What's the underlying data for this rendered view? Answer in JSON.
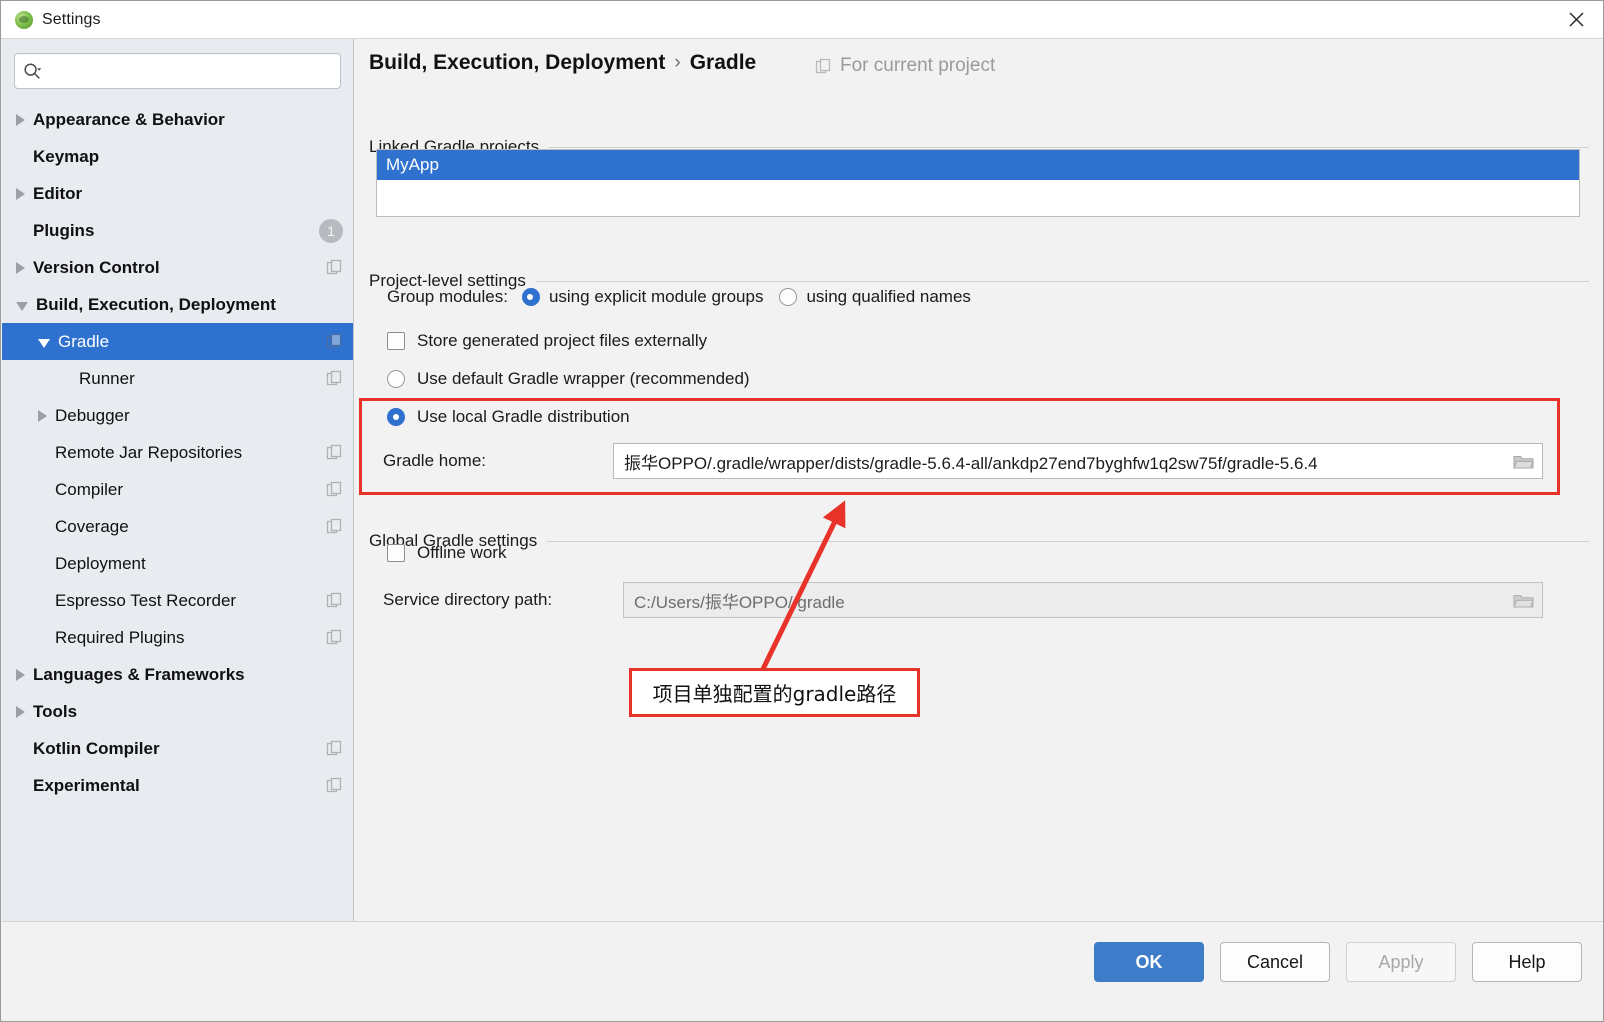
{
  "window": {
    "title": "Settings",
    "app_icon": "android-studio-icon",
    "close_icon": "close-icon"
  },
  "sidebar": {
    "search": {
      "value": "",
      "placeholder": "",
      "icon": "search-icon"
    },
    "items": [
      {
        "label": "Appearance & Behavior",
        "level": 0,
        "bold": true,
        "arrow": "collapsed",
        "badge": "",
        "config_icon": false,
        "selected": false
      },
      {
        "label": "Keymap",
        "level": 0,
        "bold": true,
        "arrow": "none",
        "badge": "",
        "config_icon": false,
        "selected": false
      },
      {
        "label": "Editor",
        "level": 0,
        "bold": true,
        "arrow": "collapsed",
        "badge": "",
        "config_icon": false,
        "selected": false
      },
      {
        "label": "Plugins",
        "level": 0,
        "bold": true,
        "arrow": "none",
        "badge": "1",
        "config_icon": false,
        "selected": false
      },
      {
        "label": "Version Control",
        "level": 0,
        "bold": true,
        "arrow": "collapsed",
        "badge": "",
        "config_icon": true,
        "selected": false
      },
      {
        "label": "Build, Execution, Deployment",
        "level": 0,
        "bold": true,
        "arrow": "expanded",
        "badge": "",
        "config_icon": false,
        "selected": false
      },
      {
        "label": "Gradle",
        "level": 1,
        "bold": false,
        "arrow": "expanded",
        "badge": "",
        "config_icon": true,
        "selected": true
      },
      {
        "label": "Runner",
        "level": 2,
        "bold": false,
        "arrow": "none",
        "badge": "",
        "config_icon": true,
        "selected": false
      },
      {
        "label": "Debugger",
        "level": 1,
        "bold": false,
        "arrow": "collapsed",
        "badge": "",
        "config_icon": false,
        "selected": false
      },
      {
        "label": "Remote Jar Repositories",
        "level": 1,
        "bold": false,
        "arrow": "none",
        "badge": "",
        "config_icon": true,
        "selected": false
      },
      {
        "label": "Compiler",
        "level": 1,
        "bold": false,
        "arrow": "none",
        "badge": "",
        "config_icon": true,
        "selected": false
      },
      {
        "label": "Coverage",
        "level": 1,
        "bold": false,
        "arrow": "none",
        "badge": "",
        "config_icon": true,
        "selected": false
      },
      {
        "label": "Deployment",
        "level": 1,
        "bold": false,
        "arrow": "none",
        "badge": "",
        "config_icon": false,
        "selected": false
      },
      {
        "label": "Espresso Test Recorder",
        "level": 1,
        "bold": false,
        "arrow": "none",
        "badge": "",
        "config_icon": true,
        "selected": false
      },
      {
        "label": "Required Plugins",
        "level": 1,
        "bold": false,
        "arrow": "none",
        "badge": "",
        "config_icon": true,
        "selected": false
      },
      {
        "label": "Languages & Frameworks",
        "level": 0,
        "bold": true,
        "arrow": "collapsed",
        "badge": "",
        "config_icon": false,
        "selected": false
      },
      {
        "label": "Tools",
        "level": 0,
        "bold": true,
        "arrow": "collapsed",
        "badge": "",
        "config_icon": false,
        "selected": false
      },
      {
        "label": "Kotlin Compiler",
        "level": 0,
        "bold": true,
        "arrow": "none",
        "badge": "",
        "config_icon": true,
        "selected": false
      },
      {
        "label": "Experimental",
        "level": 0,
        "bold": true,
        "arrow": "none",
        "badge": "",
        "config_icon": true,
        "selected": false
      }
    ]
  },
  "main": {
    "breadcrumb": {
      "parent": "Build, Execution, Deployment",
      "separator": "›",
      "current": "Gradle"
    },
    "scope_badge": {
      "label": "For current project",
      "icon": "copy-project-icon"
    },
    "linked_projects": {
      "section_title": "Linked Gradle projects",
      "items": [
        "MyApp"
      ],
      "selected_index": 0
    },
    "project_level": {
      "section_title": "Project-level settings",
      "group_modules_label": "Group modules:",
      "group_modules_options": [
        {
          "label": "using explicit module groups",
          "selected": true
        },
        {
          "label": "using qualified names",
          "selected": false
        }
      ],
      "store_externally": {
        "label": "Store generated project files externally",
        "checked": false
      },
      "use_wrapper": {
        "label": "Use default Gradle wrapper (recommended)",
        "selected": false
      },
      "use_local": {
        "label": "Use local Gradle distribution",
        "selected": true
      },
      "gradle_home_label": "Gradle home:",
      "gradle_home_value": "振华OPPO/.gradle/wrapper/dists/gradle-5.6.4-all/ankdp27end7byghfw1q2sw75f/gradle-5.6.4",
      "browse_icon": "folder-icon"
    },
    "global_settings": {
      "section_title": "Global Gradle settings",
      "offline_work": {
        "label": "Offline work",
        "checked": false
      },
      "service_dir_label": "Service directory path:",
      "service_dir_value": "C:/Users/振华OPPO/.gradle",
      "browse_icon": "folder-icon"
    }
  },
  "annotations": {
    "highlight_color": "#e8332a",
    "callout_text": "项目单独配置的gradle路径"
  },
  "footer": {
    "buttons": [
      {
        "label": "OK",
        "style": "primary",
        "enabled": true
      },
      {
        "label": "Cancel",
        "style": "default",
        "enabled": true
      },
      {
        "label": "Apply",
        "style": "disabled",
        "enabled": false
      },
      {
        "label": "Help",
        "style": "default",
        "enabled": true
      }
    ]
  }
}
